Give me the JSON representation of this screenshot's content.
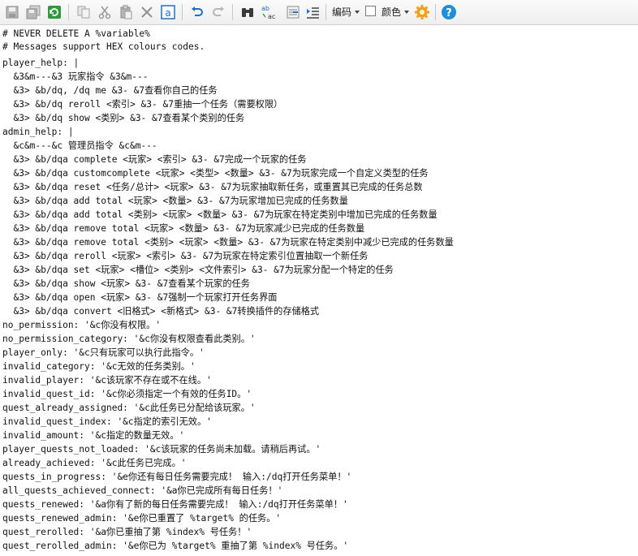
{
  "toolbar": {
    "encoding_label": "编码",
    "color_label": "颜色",
    "icons": [
      "save-icon",
      "save-all-icon",
      "refresh-icon",
      "copy-icon",
      "cut-icon",
      "paste-icon",
      "delete-icon",
      "text-a-icon",
      "undo-icon",
      "redo-icon",
      "find-icon",
      "replace-icon",
      "goto-icon",
      "indent-icon",
      "settings-gear-icon",
      "help-icon"
    ],
    "colors": {
      "accent_blue": "#1e6ec8",
      "gear_orange": "#f2a21a",
      "refresh_green": "#2e9b3a"
    }
  },
  "editor": {
    "lines": [
      "# NEVER DELETE A %variable%",
      "# Messages support HEX colours codes.",
      "",
      "player_help: |",
      "  &3&m---&3 玩家指令 &3&m---",
      "  &3> &b/dq, /dq me &3- &7查看你自己的任务",
      "  &3> &b/dq reroll <索引> &3- &7重抽一个任务（需要权限）",
      "  &3> &b/dq show <类别> &3- &7查看某个类别的任务",
      "admin_help: |",
      "  &c&m---&c 管理员指令 &c&m---",
      "  &3> &b/dqa complete <玩家> <索引> &3- &7完成一个玩家的任务",
      "  &3> &b/dqa customcomplete <玩家> <类型> <数量> &3- &7为玩家完成一个自定义类型的任务",
      "  &3> &b/dqa reset <任务/总计> <玩家> &3- &7为玩家抽取新任务，或重置其已完成的任务总数",
      "  &3> &b/dqa add total <玩家> <数量> &3- &7为玩家增加已完成的任务数量",
      "  &3> &b/dqa add total <类别> <玩家> <数量> &3- &7为玩家在特定类别中增加已完成的任务数量",
      "  &3> &b/dqa remove total <玩家> <数量> &3- &7为玩家减少已完成的任务数量",
      "  &3> &b/dqa remove total <类别> <玩家> <数量> &3- &7为玩家在特定类别中减少已完成的任务数量",
      "  &3> &b/dqa reroll <玩家> <索引> &3- &7为玩家在特定索引位置抽取一个新任务",
      "  &3> &b/dqa set <玩家> <槽位> <类别> <文件索引> &3- &7为玩家分配一个特定的任务",
      "  &3> &b/dqa show <玩家> &3- &7查看某个玩家的任务",
      "  &3> &b/dqa open <玩家> &3- &7强制一个玩家打开任务界面",
      "  &3> &b/dqa convert <旧格式> <新格式> &3- &7转换插件的存储格式",
      "no_permission: '&c你没有权限。'",
      "no_permission_category: '&c你没有权限查看此类别。'",
      "player_only: '&c只有玩家可以执行此指令。'",
      "invalid_category: '&c无效的任务类别。'",
      "invalid_player: '&c该玩家不存在或不在线。'",
      "invalid_quest_id: '&c你必须指定一个有效的任务ID。'",
      "quest_already_assigned: '&c此任务已分配给该玩家。'",
      "invalid_quest_index: '&c指定的索引无效。'",
      "invalid_amount: '&c指定的数量无效。'",
      "player_quests_not_loaded: '&c该玩家的任务尚未加载。请稍后再试。'",
      "already_achieved: '&c此任务已完成。'",
      "quests_in_progress: '&e你还有每日任务需要完成！ 输入:/dq打开任务菜单！'",
      "all_quests_achieved_connect: '&a你已完成所有每日任务！'",
      "quests_renewed: '&a你有了新的每日任务需要完成！ 输入:/dq打开任务菜单！'",
      "quests_renewed_admin: '&e你已重置了 %target% 的任务。'",
      "quest_rerolled: '&a你已重抽了第 %index% 号任务！'",
      "quest_rerolled_admin: '&e你已为 %target% 重抽了第 %index% 号任务。'"
    ]
  }
}
